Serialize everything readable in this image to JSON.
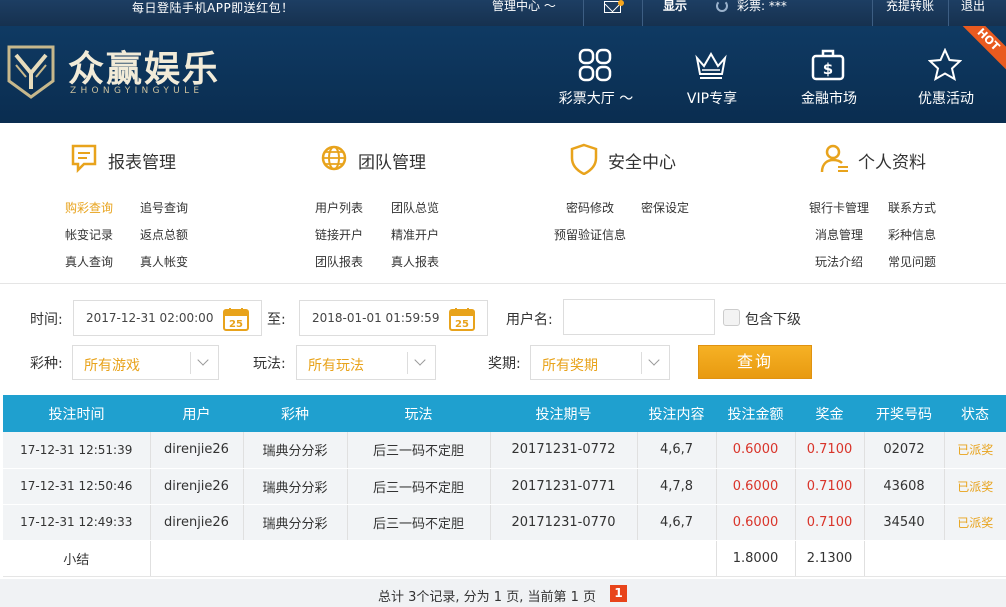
{
  "topbar": {
    "notice": "每日登陆手机APP即送红包！",
    "management": "管理中心 ～",
    "show": "显示",
    "balance_label": "彩票: ***",
    "deposit_transfer": "充提转账",
    "logout": "退出"
  },
  "brand": {
    "name": "众赢娱乐",
    "subtitle": "ZHONGYINGYULE"
  },
  "nav": [
    {
      "label": "彩票大厅 ～",
      "icon": "grid-icon"
    },
    {
      "label": "VIP专享",
      "icon": "crown-icon"
    },
    {
      "label": "金融市场",
      "icon": "briefcase-dollar-icon"
    },
    {
      "label": "优惠活动",
      "icon": "star-icon",
      "badge": "HOT"
    }
  ],
  "menu": {
    "report": {
      "title": "报表管理",
      "links": [
        "购彩查询",
        "追号查询",
        "帐变记录",
        "返点总额",
        "真人查询",
        "真人帐变"
      ]
    },
    "team": {
      "title": "团队管理",
      "links": [
        "用户列表",
        "团队总览",
        "链接开户",
        "精准开户",
        "团队报表",
        "真人报表"
      ]
    },
    "security": {
      "title": "安全中心",
      "links": [
        "密码修改",
        "密保设定",
        "预留验证信息"
      ]
    },
    "profile": {
      "title": "个人资料",
      "links": [
        "银行卡管理",
        "联系方式",
        "消息管理",
        "彩种信息",
        "玩法介绍",
        "常见问题"
      ]
    }
  },
  "filter": {
    "time_label": "时间:",
    "start_time": "2017-12-31 02:00:00",
    "to_label": "至:",
    "end_time": "2018-01-01 01:59:59",
    "calendar_day": "25",
    "username_label": "用户名:",
    "username_value": "",
    "include_sub": "包含下级",
    "lottery_label": "彩种:",
    "lottery_value": "所有游戏",
    "play_label": "玩法:",
    "play_value": "所有玩法",
    "period_label": "奖期:",
    "period_value": "所有奖期",
    "query_button": "查询"
  },
  "table": {
    "headers": [
      "投注时间",
      "用户",
      "彩种",
      "玩法",
      "投注期号",
      "投注内容",
      "投注金额",
      "奖金",
      "开奖号码",
      "状态"
    ],
    "rows": [
      [
        "17-12-31 12:51:39",
        "direnjie26",
        "瑞典分分彩",
        "后三一码不定胆",
        "20171231-0772",
        "4,6,7",
        "0.6000",
        "0.7100",
        "02072",
        "已派奖"
      ],
      [
        "17-12-31 12:50:46",
        "direnjie26",
        "瑞典分分彩",
        "后三一码不定胆",
        "20171231-0771",
        "4,7,8",
        "0.6000",
        "0.7100",
        "43608",
        "已派奖"
      ],
      [
        "17-12-31 12:49:33",
        "direnjie26",
        "瑞典分分彩",
        "后三一码不定胆",
        "20171231-0770",
        "4,6,7",
        "0.6000",
        "0.7100",
        "34540",
        "已派奖"
      ]
    ],
    "summary": {
      "label": "小结",
      "amount": "1.8000",
      "prize": "2.1300"
    }
  },
  "pager": {
    "text": "总计 3个记录, 分为 1 页, 当前第 1 页",
    "current": "1"
  },
  "colors": {
    "accent": "#e8a31c",
    "header_bg": "#0f3a63",
    "table_head": "#1fa0cf",
    "money_red": "#d9342a"
  }
}
